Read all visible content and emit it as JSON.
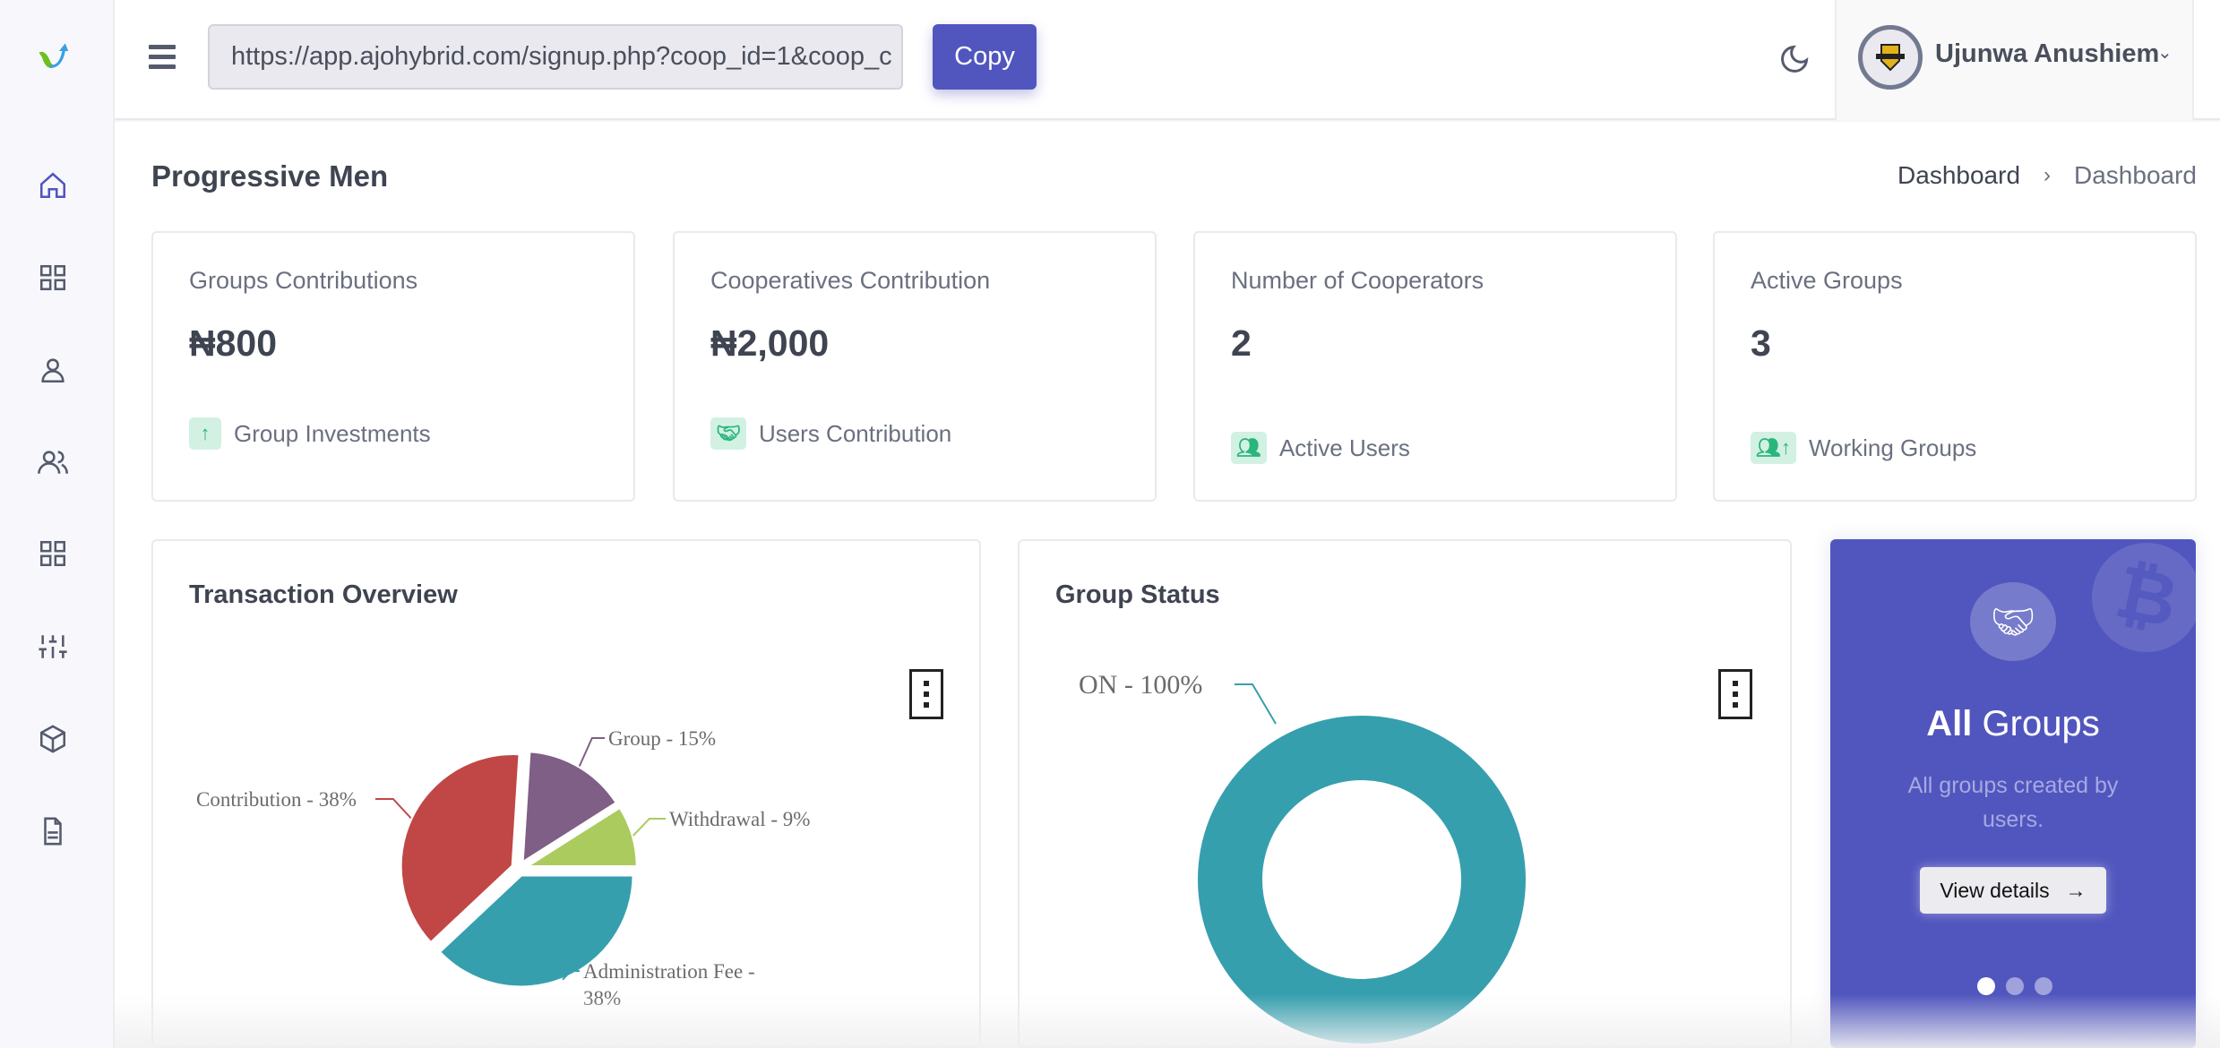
{
  "topbar": {
    "signup_url": "https://app.ajohybrid.com/signup.php?coop_id=1&coop_c",
    "copy_label": "Copy",
    "user_name": "Ujunwa Anushiem"
  },
  "page": {
    "title": "Progressive Men",
    "breadcrumb": [
      "Dashboard",
      "Dashboard"
    ]
  },
  "sidebar": {
    "items": [
      "home-icon",
      "grid-icon",
      "user-icon",
      "users-icon",
      "grid-icon",
      "sliders-icon",
      "box-icon",
      "file-text-icon"
    ]
  },
  "stats": [
    {
      "title": "Groups Contributions",
      "value": "₦800",
      "footer": "Group Investments",
      "icon": "arrow-up-icon"
    },
    {
      "title": "Cooperatives Contribution",
      "value": "₦2,000",
      "footer": "Users Contribution",
      "icon": "handshake-icon"
    },
    {
      "title": "Number of Cooperators",
      "value": "2",
      "footer": "Active Users",
      "icon": "users-icon"
    },
    {
      "title": "Active Groups",
      "value": "3",
      "footer": "Working Groups",
      "icon": "users-arrow-up-icon"
    }
  ],
  "chart_data": [
    {
      "type": "pie",
      "title": "Transaction Overview",
      "categories": [
        "Administration Fee",
        "Contribution",
        "Group",
        "Withdrawal"
      ],
      "values": [
        38,
        38,
        15,
        9
      ],
      "labels": [
        "Administration Fee - 38%",
        "Contribution - 38%",
        "Group - 15%",
        "Withdrawal - 9%"
      ],
      "colors": [
        "#369fae",
        "#c04745",
        "#7f5f86",
        "#abcb5f"
      ]
    },
    {
      "type": "pie",
      "title": "Group Status",
      "categories": [
        "ON"
      ],
      "values": [
        100
      ],
      "labels": [
        "ON - 100%"
      ],
      "colors": [
        "#369fae"
      ]
    }
  ],
  "promo": {
    "title_bold": "All",
    "title_rest": "Groups",
    "description": "All groups created by users.",
    "button": "View details",
    "slides": 3,
    "active_slide": 1,
    "bg": "#5156be"
  }
}
